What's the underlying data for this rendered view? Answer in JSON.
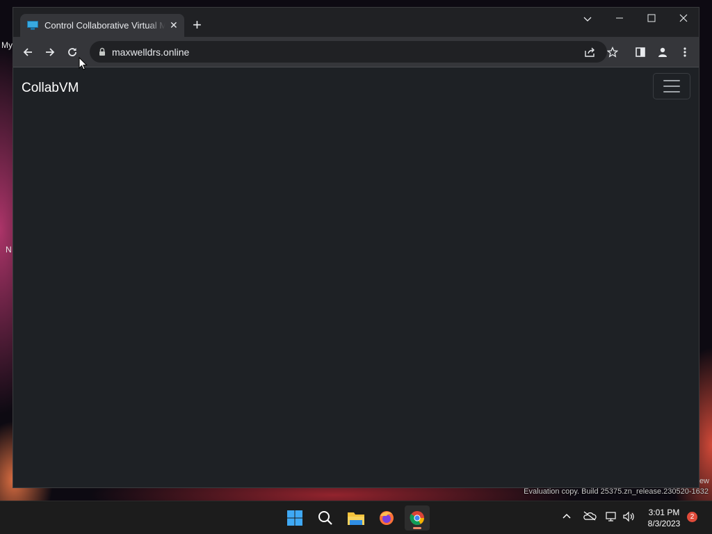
{
  "desktop": {
    "fragments": [
      "My",
      "N"
    ],
    "watermark": "Evaluation copy. Build 25375.zn_release.230520-1632",
    "watermark_top": "ew"
  },
  "browser": {
    "tab": {
      "title": "Control Collaborative Virtual Machine",
      "favicon": "monitor-icon"
    },
    "new_tab_icon": "plus-icon",
    "window_controls": {
      "tab_search": "chevron-down-icon",
      "minimize": "minimize-icon",
      "maximize": "maximize-icon",
      "close": "close-icon"
    },
    "toolbar": {
      "back": "arrow-left-icon",
      "forward": "arrow-right-icon",
      "reload": "reload-icon",
      "url": "maxwelldrs.online",
      "share": "share-icon",
      "bookmark": "star-icon",
      "side_panel": "side-panel-icon",
      "profile": "person-icon",
      "menu": "kebab-menu-icon"
    }
  },
  "page": {
    "brand": "CollabVM",
    "nav_toggle": "hamburger-icon",
    "background_color": "#1e2125"
  },
  "taskbar": {
    "apps": [
      "start-icon",
      "search-icon",
      "file-explorer-icon",
      "firefox-icon",
      "chrome-icon"
    ],
    "active_app": "chrome-icon",
    "tray": [
      "chevron-up-icon",
      "onedrive-icon",
      "network-icon",
      "volume-icon"
    ],
    "time": "3:01 PM",
    "date": "8/3/2023",
    "notifications": "2"
  },
  "colors": {
    "window_bg": "#202124",
    "toolbar_bg": "#35363a",
    "taskbar_bg": "#1c1c1c",
    "notification_badge": "#e04b3a"
  }
}
